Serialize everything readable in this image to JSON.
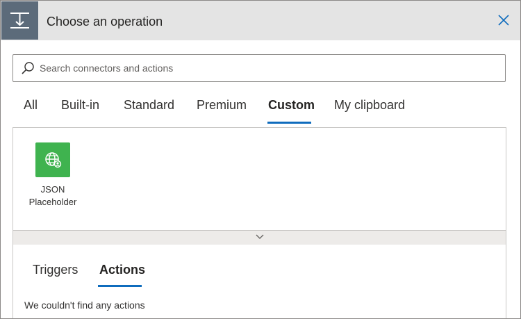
{
  "header": {
    "title": "Choose an operation",
    "icon": "operation-icon",
    "close_icon": "close-icon"
  },
  "search": {
    "placeholder": "Search connectors and actions",
    "value": "",
    "icon": "search-icon"
  },
  "tabs": [
    {
      "label": "All",
      "active": false
    },
    {
      "label": "Built-in",
      "active": false
    },
    {
      "label": "Standard",
      "active": false
    },
    {
      "label": "Premium",
      "active": false
    },
    {
      "label": "Custom",
      "active": true
    },
    {
      "label": "My clipboard",
      "active": false
    }
  ],
  "connectors": [
    {
      "label_line1": "JSON",
      "label_line2": "Placeholder",
      "icon": "globe-user-icon",
      "color": "#3fb34f"
    }
  ],
  "results": {
    "tabs": [
      {
        "label": "Triggers",
        "active": false
      },
      {
        "label": "Actions",
        "active": true
      }
    ],
    "empty_message": "We couldn't find any actions"
  },
  "colors": {
    "accent": "#0f6cbd",
    "header_bg": "#e4e4e4",
    "header_icon_bg": "#5c6b7a",
    "connector_green": "#3fb34f"
  }
}
